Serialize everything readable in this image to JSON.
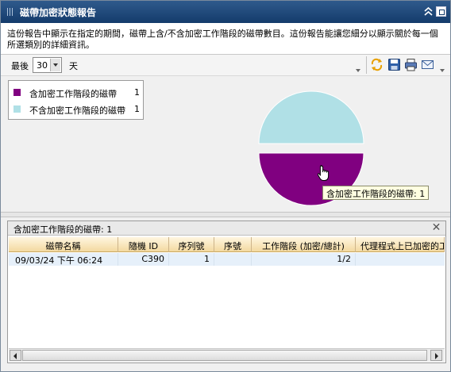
{
  "window": {
    "title": "磁帶加密狀態報告"
  },
  "description": {
    "line1": "這份報告中顯示在指定的期間，磁帶上含/不含加密工作階段的磁帶數目。這份報告能讓您細分以顯示關於每一個",
    "line2": "所選類別的詳細資訊。"
  },
  "toolbar": {
    "last_label": "最後",
    "days_value": "30",
    "days_unit": "天",
    "icons": [
      "refresh-icon",
      "save-icon",
      "print-icon",
      "email-icon"
    ]
  },
  "legend": {
    "items": [
      {
        "label": "含加密工作階段的磁帶",
        "value": "1",
        "color": "#800080"
      },
      {
        "label": "不含加密工作階段的磁帶",
        "value": "1",
        "color": "#b0e0e6"
      }
    ]
  },
  "tooltip": {
    "text": "含加密工作階段的磁帶: 1"
  },
  "chart_data": {
    "type": "pie",
    "slices": [
      {
        "label": "不含加密工作階段的磁帶",
        "value": 1,
        "color": "#b0e0e6",
        "exploded": false
      },
      {
        "label": "含加密工作階段的磁帶",
        "value": 1,
        "color": "#800080",
        "exploded": true
      }
    ]
  },
  "detail": {
    "title": "含加密工作階段的磁帶: 1",
    "columns": [
      "磁帶名稱",
      "隨機 ID",
      "序列號",
      "序號",
      "工作階段 (加密/總計)",
      "代理程式上已加密的工作"
    ],
    "rows": [
      [
        "09/03/24 下午 06:24",
        "C390",
        "1",
        "",
        "1/2",
        ""
      ]
    ]
  }
}
